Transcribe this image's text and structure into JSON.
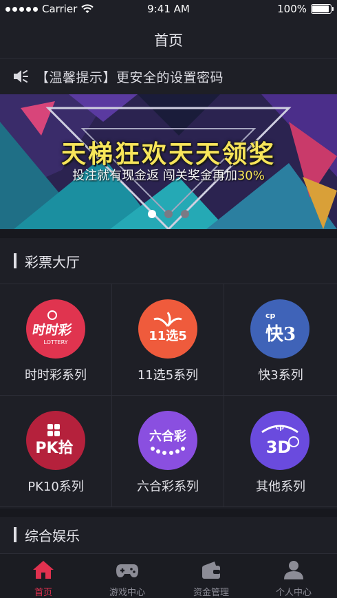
{
  "status_bar": {
    "carrier": "Carrier",
    "time": "9:41 AM",
    "battery": "100%",
    "battery_level": 1.0
  },
  "nav": {
    "title": "首页"
  },
  "notice": {
    "text": "【温馨提示】更安全的设置密码"
  },
  "banner": {
    "headline": "天梯狂欢天天领奖",
    "sub_prefix": "投注就有现金返 闯关奖金再加",
    "sub_highlight": "30%",
    "pages": 3,
    "active_page": 1
  },
  "lottery_hall": {
    "title": "彩票大厅",
    "items": [
      {
        "label": "时时彩系列",
        "icon": "shishicai-logo-icon",
        "color": "#e0344f",
        "logo_text": "时时彩"
      },
      {
        "label": "11选5系列",
        "icon": "11xuan5-logo-icon",
        "color": "#ef5b3c",
        "logo_text": "11选5"
      },
      {
        "label": "快3系列",
        "icon": "kuai3-logo-icon",
        "color": "#3f63b8",
        "logo_text": "快3"
      },
      {
        "label": "PK10系列",
        "icon": "pk10-logo-icon",
        "color": "#b5213c",
        "logo_text": "PK拾"
      },
      {
        "label": "六合彩系列",
        "icon": "liuhecai-logo-icon",
        "color": "#8a4fe0",
        "logo_text": "六合彩"
      },
      {
        "label": "其他系列",
        "icon": "other-3d-logo-icon",
        "color": "#6a4bde",
        "logo_text": "3D"
      }
    ]
  },
  "entertainment": {
    "title": "综合娱乐"
  },
  "tabbar": {
    "items": [
      {
        "label": "首页",
        "icon": "home-icon",
        "active": true
      },
      {
        "label": "游戏中心",
        "icon": "gamepad-icon",
        "active": false
      },
      {
        "label": "资金管理",
        "icon": "wallet-icon",
        "active": false
      },
      {
        "label": "个人中心",
        "icon": "user-icon",
        "active": false
      }
    ]
  },
  "colors": {
    "accent": "#e0314f",
    "background": "#1e1f26"
  }
}
